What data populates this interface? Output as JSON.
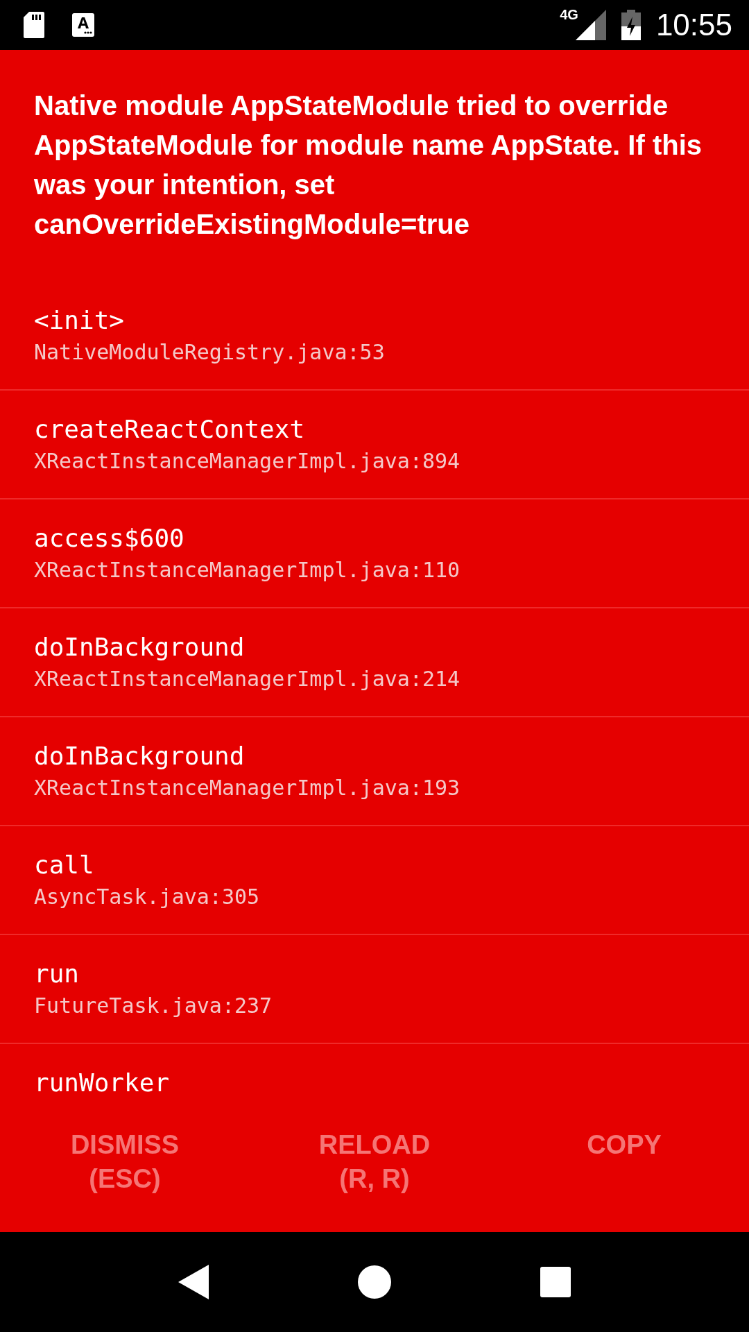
{
  "status_bar": {
    "network": "4G",
    "time": "10:55"
  },
  "error": {
    "message": "Native module AppStateModule tried to override AppStateModule for module name AppState. If this was your intention, set canOverrideExistingModule=true"
  },
  "stack_frames": [
    {
      "method": "<init>",
      "file": "NativeModuleRegistry.java:53"
    },
    {
      "method": "createReactContext",
      "file": "XReactInstanceManagerImpl.java:894"
    },
    {
      "method": "access$600",
      "file": "XReactInstanceManagerImpl.java:110"
    },
    {
      "method": "doInBackground",
      "file": "XReactInstanceManagerImpl.java:214"
    },
    {
      "method": "doInBackground",
      "file": "XReactInstanceManagerImpl.java:193"
    },
    {
      "method": "call",
      "file": "AsyncTask.java:305"
    },
    {
      "method": "run",
      "file": "FutureTask.java:237"
    },
    {
      "method": "runWorker"
    }
  ],
  "buttons": [
    {
      "label": "DISMISS\n(ESC)"
    },
    {
      "label": "RELOAD\n(R, R)"
    },
    {
      "label": "COPY"
    }
  ]
}
